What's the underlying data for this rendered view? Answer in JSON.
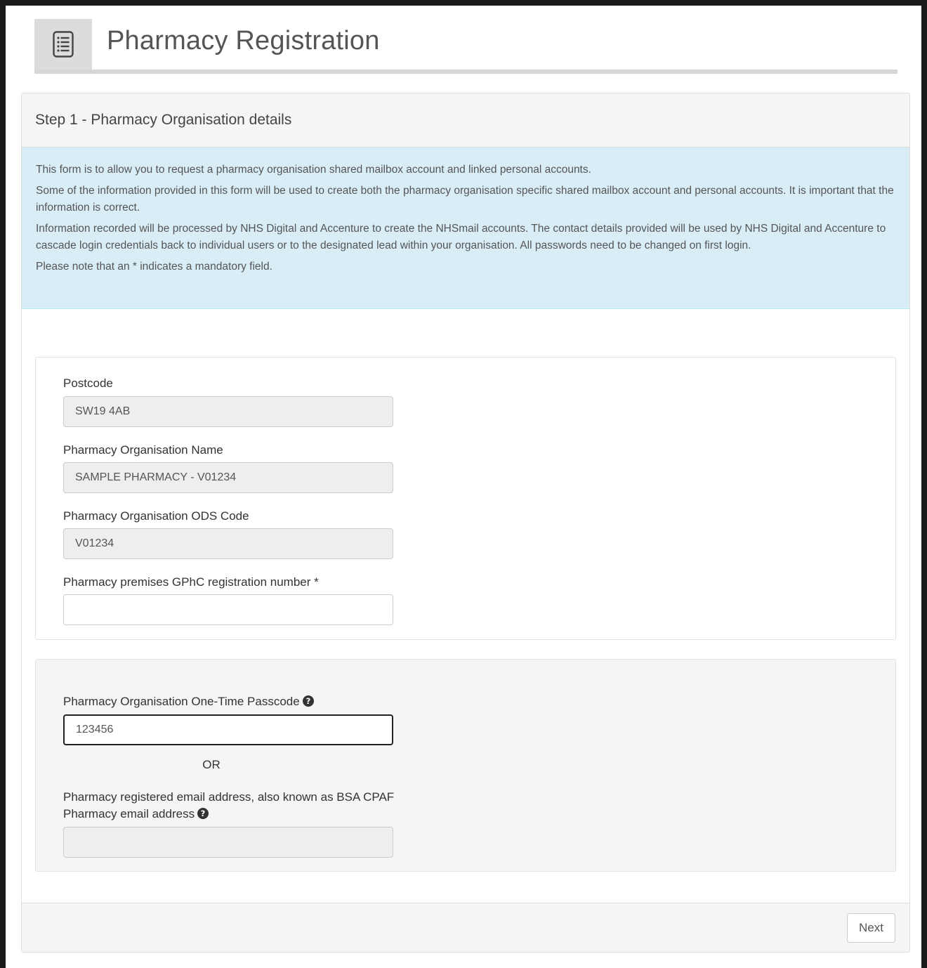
{
  "header": {
    "title": "Pharmacy Registration",
    "icon": "list-document-icon"
  },
  "panel": {
    "heading": "Step 1 - Pharmacy Organisation details",
    "info": [
      "This form is to allow you to request a pharmacy organisation shared mailbox account and linked personal accounts.",
      "Some of the information provided in this form will be used to create both the pharmacy organisation specific shared mailbox account and personal accounts. It is important that the information is correct.",
      "Information recorded will be processed by NHS Digital and Accenture to create the NHSmail accounts. The contact details provided will be used by NHS Digital and Accenture to cascade login credentials back to individual users or to the designated lead within your organisation. All passwords need to be changed on first login.",
      "Please note that an * indicates a mandatory field."
    ]
  },
  "fields": {
    "postcode": {
      "label": "Postcode",
      "value": "SW19 4AB"
    },
    "org_name": {
      "label": "Pharmacy Organisation Name",
      "value": "SAMPLE PHARMACY - V01234"
    },
    "ods_code": {
      "label": "Pharmacy Organisation ODS Code",
      "value": "V01234"
    },
    "gphc": {
      "label": "Pharmacy premises GPhC registration number *",
      "value": ""
    },
    "passcode": {
      "label": "Pharmacy Organisation One-Time Passcode",
      "value": "123456"
    },
    "or_text": "OR",
    "email": {
      "label_line1": "Pharmacy registered email address, also known as BSA CPAF",
      "label_line2": "Pharmacy email address",
      "value": ""
    }
  },
  "footer": {
    "next_label": "Next"
  },
  "colors": {
    "info_bg": "#d9edf7",
    "panel_heading_bg": "#f5f5f5",
    "readonly_input_bg": "#eeeeee"
  }
}
